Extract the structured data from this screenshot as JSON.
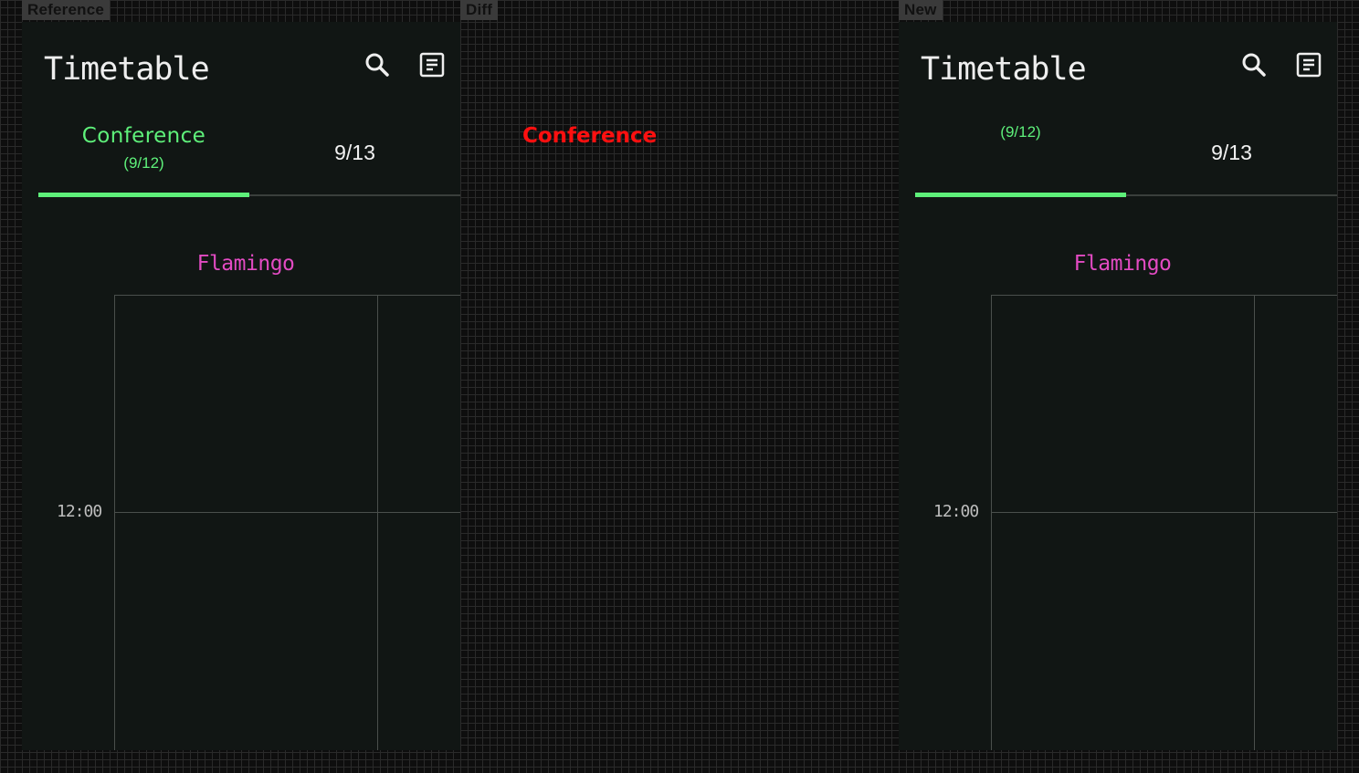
{
  "labels": {
    "reference": "Reference",
    "diff": "Diff",
    "new": "New"
  },
  "reference_screen": {
    "title": "Timetable",
    "icons": [
      "search-icon",
      "schedule-list-icon"
    ],
    "tabs": [
      {
        "name": "Conference",
        "date": "(9/12)",
        "selected": true
      },
      {
        "name": "9/13",
        "selected": false
      }
    ],
    "room": "Flamingo",
    "time_label": "12:00"
  },
  "diff_panel": {
    "text": "Conference"
  },
  "new_screen": {
    "title": "Timetable",
    "icons": [
      "search-icon",
      "schedule-list-icon"
    ],
    "tabs": [
      {
        "name": "",
        "date": "(9/12)",
        "selected": true
      },
      {
        "name": "9/13",
        "selected": false
      }
    ],
    "room": "Flamingo",
    "time_label": "12:00"
  },
  "colors": {
    "accent": "#5ef07a",
    "room": "#e34bc3",
    "diff": "#ff1010",
    "screen_background": "#111614"
  }
}
